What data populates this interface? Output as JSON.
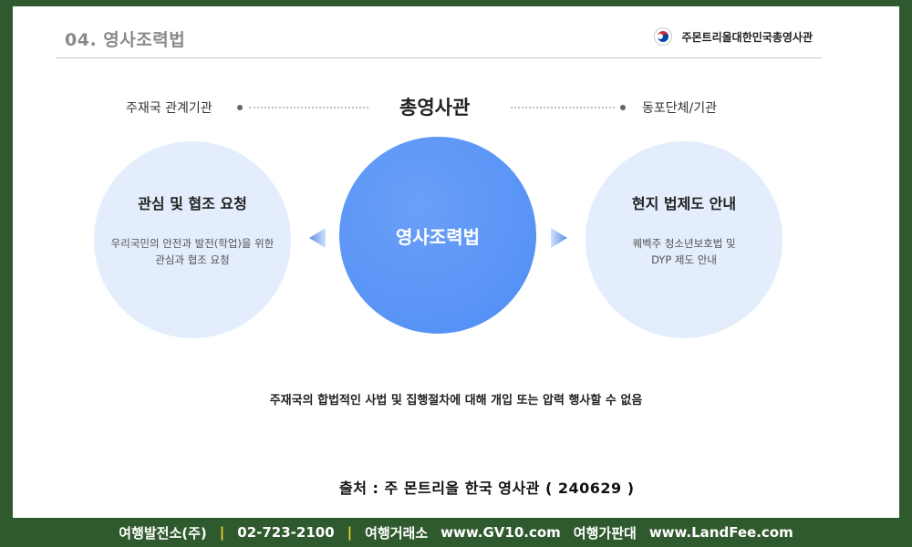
{
  "header": {
    "title": "04. 영사조력법",
    "org_name": "주몬트리올대한민국총영사관"
  },
  "top": {
    "left_label": "주재국 관계기관",
    "center_label": "총영사관",
    "right_label": "동포단체/기관"
  },
  "circles": {
    "left": {
      "title": "관심 및 협조 요청",
      "desc_line1": "우리국민의 안전과 발전(학업)을 위한",
      "desc_line2": "관심과 협조 요청"
    },
    "center": {
      "title": "영사조력법"
    },
    "right": {
      "title": "현지 법제도 안내",
      "desc_line1": "퀘벡주 청소년보호법 및",
      "desc_line2": "DYP 제도 안내"
    }
  },
  "note": "주재국의 합법적인 사법 및 집행절차에 대해 개입 또는 압력 행사할 수 없음",
  "source": "출처 : 주 몬트리올 한국 영사관 ( 240629 )",
  "footer": {
    "company": "여행발전소(주)",
    "phone": "02-723-2100",
    "site1_label": "여행거래소",
    "site1_url": "www.GV10.com",
    "site2_label": "여행가판대",
    "site2_url": "www.LandFee.com",
    "separator": "|"
  },
  "colors": {
    "background_frame": "#2f5a2d",
    "center_circle": "#5b96f7",
    "side_circle": "#e3edfc",
    "footer_separator": "#f5d42b"
  },
  "icons": {
    "seal": "korea-taegeuk-seal-icon",
    "left_arrow": "chevron-left-icon",
    "right_arrow": "chevron-right-icon"
  }
}
